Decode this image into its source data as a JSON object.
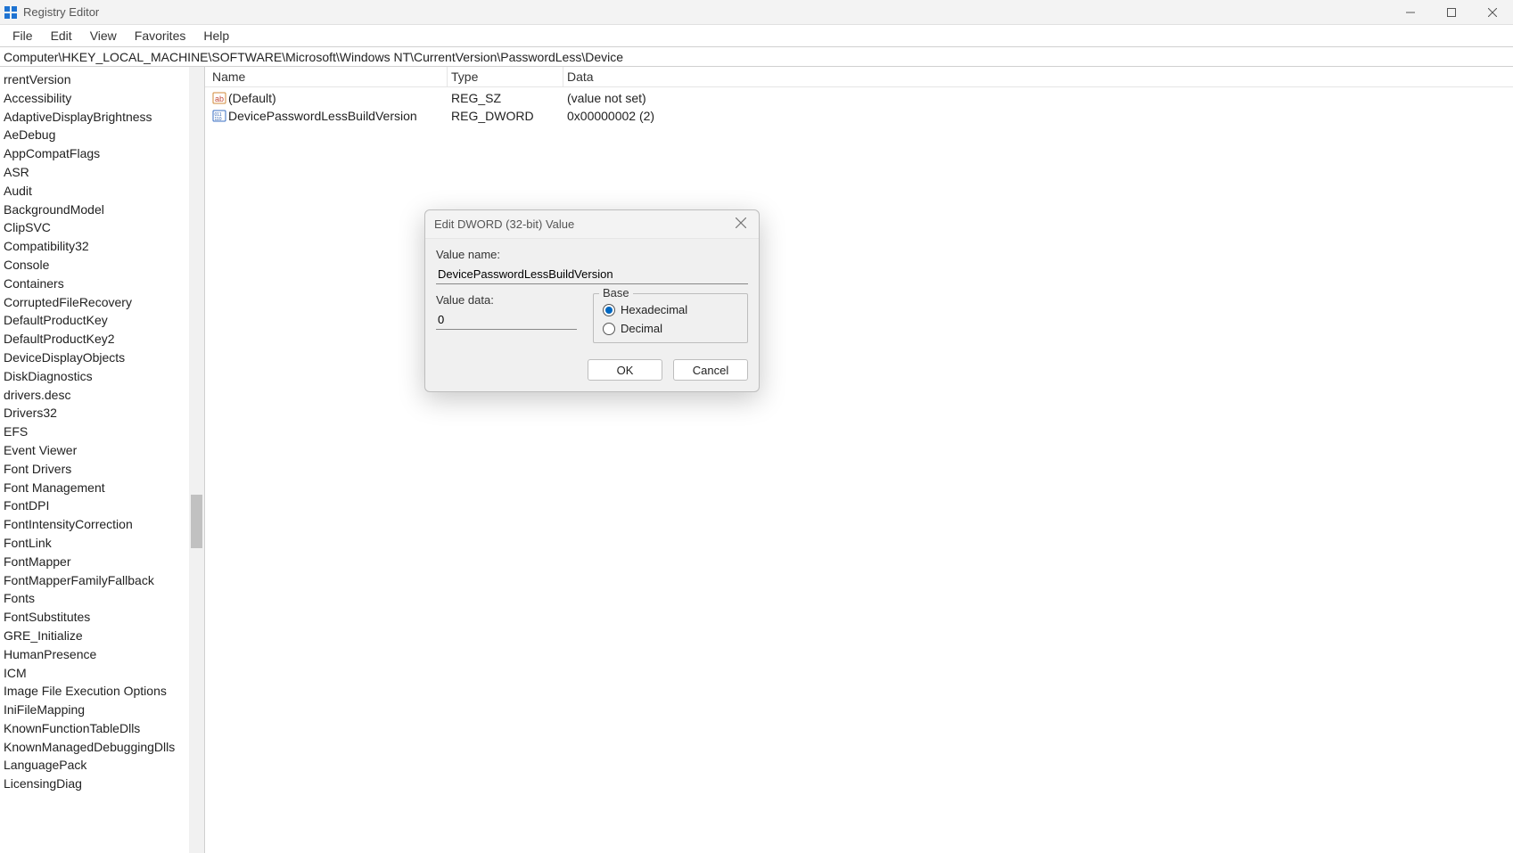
{
  "window": {
    "title": "Registry Editor"
  },
  "menubar": {
    "items": [
      "File",
      "Edit",
      "View",
      "Favorites",
      "Help"
    ]
  },
  "addressbar": {
    "path": "Computer\\HKEY_LOCAL_MACHINE\\SOFTWARE\\Microsoft\\Windows NT\\CurrentVersion\\PasswordLess\\Device"
  },
  "tree": {
    "items": [
      "rrentVersion",
      "Accessibility",
      "AdaptiveDisplayBrightness",
      "AeDebug",
      "AppCompatFlags",
      "ASR",
      "Audit",
      "BackgroundModel",
      "ClipSVC",
      "Compatibility32",
      "Console",
      "Containers",
      "CorruptedFileRecovery",
      "DefaultProductKey",
      "DefaultProductKey2",
      "DeviceDisplayObjects",
      "DiskDiagnostics",
      "drivers.desc",
      "Drivers32",
      "EFS",
      "Event Viewer",
      "Font Drivers",
      "Font Management",
      "FontDPI",
      "FontIntensityCorrection",
      "FontLink",
      "FontMapper",
      "FontMapperFamilyFallback",
      "Fonts",
      "FontSubstitutes",
      "GRE_Initialize",
      "HumanPresence",
      "ICM",
      "Image File Execution Options",
      "IniFileMapping",
      "KnownFunctionTableDlls",
      "KnownManagedDebuggingDlls",
      "LanguagePack",
      "LicensingDiag"
    ]
  },
  "list": {
    "columns": {
      "name": "Name",
      "type": "Type",
      "data": "Data"
    },
    "rows": [
      {
        "icon": "string",
        "name": "(Default)",
        "type": "REG_SZ",
        "data": "(value not set)"
      },
      {
        "icon": "binary",
        "name": "DevicePasswordLessBuildVersion",
        "type": "REG_DWORD",
        "data": "0x00000002 (2)"
      }
    ]
  },
  "dialog": {
    "title": "Edit DWORD (32-bit) Value",
    "value_name_label": "Value name:",
    "value_name": "DevicePasswordLessBuildVersion",
    "value_data_label": "Value data:",
    "value_data": "0",
    "base_label": "Base",
    "radio_hex": "Hexadecimal",
    "radio_dec": "Decimal",
    "base_selected": "hex",
    "ok": "OK",
    "cancel": "Cancel"
  }
}
